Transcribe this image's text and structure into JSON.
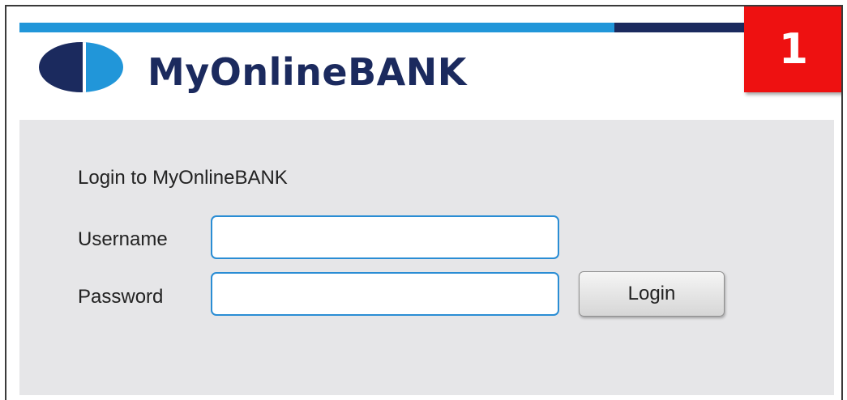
{
  "header": {
    "brand_name": "MyOnlineBANK",
    "step_badge": "1"
  },
  "login": {
    "title": "Login to MyOnlineBANK",
    "username_label": "Username",
    "username_value": "",
    "password_label": "Password",
    "password_value": "",
    "login_button": "Login"
  },
  "colors": {
    "brand_dark": "#1b2a5e",
    "brand_light": "#2196d9",
    "badge_red": "#ee1111",
    "panel_bg": "#e6e6e8",
    "input_border": "#2a8dd4"
  },
  "icons": {
    "logo": "split-circle-logo-icon"
  }
}
